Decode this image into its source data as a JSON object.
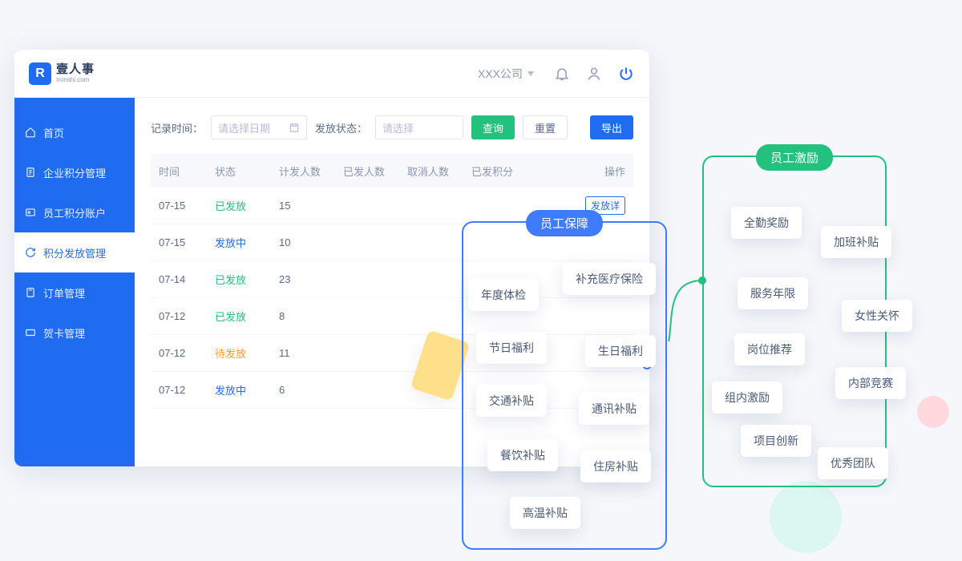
{
  "brand": {
    "badge": "R",
    "cn": "壹人事",
    "en": "Ironshi.com"
  },
  "header": {
    "company": "XXX公司"
  },
  "sidebar": {
    "items": [
      {
        "label": "首页"
      },
      {
        "label": "企业积分管理"
      },
      {
        "label": "员工积分账户"
      },
      {
        "label": "积分发放管理"
      },
      {
        "label": "订单管理"
      },
      {
        "label": "贺卡管理"
      }
    ],
    "active_index": 3
  },
  "filters": {
    "time_label": "记录时间：",
    "date_placeholder": "请选择日期",
    "status_label": "发放状态：",
    "status_placeholder": "请选择",
    "query": "查询",
    "reset": "重置",
    "export": "导出"
  },
  "table": {
    "headers": [
      "时间",
      "状态",
      "计发人数",
      "已发人数",
      "取消人数",
      "已发积分",
      "操作"
    ],
    "rows": [
      {
        "date": "07-15",
        "status": "已发放",
        "status_cls": "st-done",
        "plan": "15",
        "op": "发放详"
      },
      {
        "date": "07-15",
        "status": "发放中",
        "status_cls": "st-doing",
        "plan": "10",
        "op": ""
      },
      {
        "date": "07-14",
        "status": "已发放",
        "status_cls": "st-done",
        "plan": "23",
        "op": ""
      },
      {
        "date": "07-12",
        "status": "已发放",
        "status_cls": "st-done",
        "plan": "8",
        "op": ""
      },
      {
        "date": "07-12",
        "status": "待发放",
        "status_cls": "st-wait",
        "plan": "11",
        "op": ""
      },
      {
        "date": "07-12",
        "status": "发放中",
        "status_cls": "st-doing",
        "plan": "6",
        "op": ""
      }
    ]
  },
  "overlay": {
    "blue_title": "员工保障",
    "green_title": "员工激励",
    "chips": {
      "b1": "年度体检",
      "b2": "节日福利",
      "b3": "交通补贴",
      "b4": "餐饮补贴",
      "b5": "高温补贴",
      "b6": "补充医疗保险",
      "b7": "生日福利",
      "b8": "通讯补贴",
      "b9": "住房补贴",
      "g1": "全勤奖励",
      "g2": "服务年限",
      "g3": "岗位推荐",
      "g4": "组内激励",
      "g5": "项目创新",
      "g6": "加班补贴",
      "g7": "女性关怀",
      "g8": "内部竞赛",
      "g9": "优秀团队"
    }
  }
}
